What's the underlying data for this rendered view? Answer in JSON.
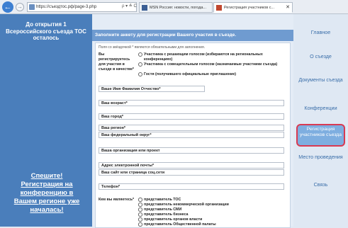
{
  "browser": {
    "back_glyph": "←",
    "forward_glyph": "→",
    "url": "https://съездтос.рф/page-3.php",
    "address_tools": "ρ ▾ ≙ C",
    "tabs": [
      {
        "label": "MSN Россия: новости, погода...",
        "close": "",
        "favicon": "msn-icon"
      },
      {
        "label": "Регистрация участников с...",
        "close": "✕",
        "favicon": "site-icon"
      }
    ]
  },
  "left_panel": {
    "countdown": "До открытия 1 Всероссийского съезда ТОС осталось",
    "promo": "Спешите! Регистрация на конференцию в Вашем регионе уже началась!"
  },
  "content": {
    "header": "Заполните анкету для регистрации Вашего участия в съезде.",
    "required_note": "Поля со звёздочкой * являются обязательными для заполнения.",
    "participation_label": "Вы регистрируетесь для участия в съезде в качестве*",
    "participation_options": [
      "Участника с решающим голосом (избираются на региональных конференциях)",
      "Участника с совещательным голосом (назначаемые участники съезда)",
      "Гостя (получившего официальные приглашение)"
    ],
    "fields": {
      "name": "Ваше Имя Фамилия Отчество*",
      "age": "Ваш возраст*",
      "city": "Ваш город*",
      "region": "Ваш регион*",
      "district": "Ваш федеральный округ*",
      "org": "Ваша организация или проект",
      "email": "Адрес электронной почты*",
      "site": "Ваш сайт или страница соц.сети",
      "phone": "Телефон*"
    },
    "you_are_label": "Кем вы являетесь*",
    "type_options": [
      "представитель ТОС",
      "представитель некоммерческой организации",
      "представитель СМИ",
      "представитель бизнеса",
      "представитель органов власти",
      "представитель Общественной палаты"
    ]
  },
  "right_nav": {
    "items": [
      "Главное",
      "О съезде",
      "Документы съезда",
      "Конференции",
      "Регистрация участников съезда",
      "Место проведения",
      "Связь"
    ],
    "active_index": 4
  },
  "colors": {
    "left_panel": "#4a7ebb",
    "header_bar": "#6f9bd0",
    "active_nav": "#7eaee0",
    "active_border": "#d93a52",
    "nav_text": "#3a6ea9"
  }
}
